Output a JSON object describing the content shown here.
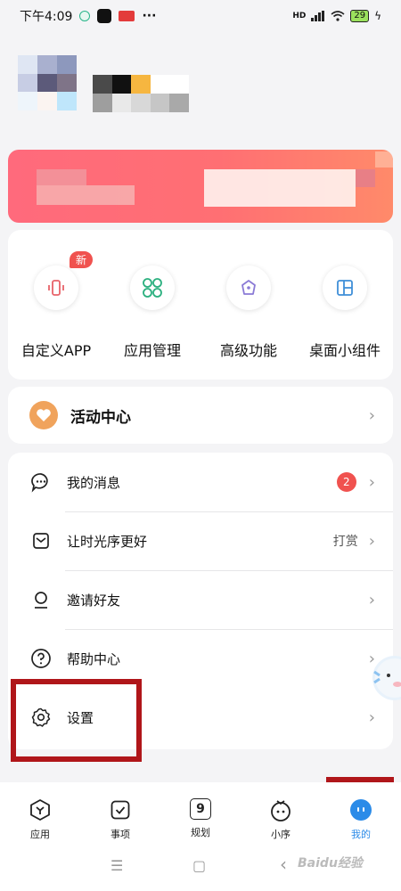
{
  "status_bar": {
    "time": "下午4:09",
    "more": "···",
    "network": "HD",
    "battery": "29"
  },
  "features": [
    {
      "name": "custom-app",
      "label": "自定义APP",
      "icon": "phone-vibrate-icon",
      "badge": "新"
    },
    {
      "name": "app-management",
      "label": "应用管理",
      "icon": "grid-circles-icon"
    },
    {
      "name": "advanced-features",
      "label": "高级功能",
      "icon": "pen-tip-icon"
    },
    {
      "name": "desktop-widgets",
      "label": "桌面小组件",
      "icon": "widget-layout-icon"
    }
  ],
  "activity": {
    "title": "活动中心",
    "icon": "heart-icon"
  },
  "menu": [
    {
      "label": "我的消息",
      "icon": "chat-bubble-icon",
      "badge": "2"
    },
    {
      "label": "让时光序更好",
      "icon": "envelope-icon",
      "aux": "打赏"
    },
    {
      "label": "邀请好友",
      "icon": "user-icon"
    },
    {
      "label": "帮助中心",
      "icon": "help-circle-icon"
    },
    {
      "label": "设置",
      "icon": "gear-icon"
    }
  ],
  "tabbar": [
    {
      "label": "应用",
      "icon": "app-hex-icon"
    },
    {
      "label": "事项",
      "icon": "checkbox-icon"
    },
    {
      "label": "规划",
      "icon": "calendar-9-icon",
      "icon_text": "9"
    },
    {
      "label": "小序",
      "icon": "mascot-icon"
    },
    {
      "label": "我的",
      "icon": "profile-face-icon",
      "active": true
    }
  ],
  "colors": {
    "accent_blue": "#2b8be8",
    "badge_red": "#f0524f",
    "highlight_red": "#b0161a",
    "banner_red": "#ff6f73"
  },
  "sysnav": {
    "menu": "☰",
    "home": "▢",
    "back": "‹"
  },
  "watermark": "Baidu经验"
}
